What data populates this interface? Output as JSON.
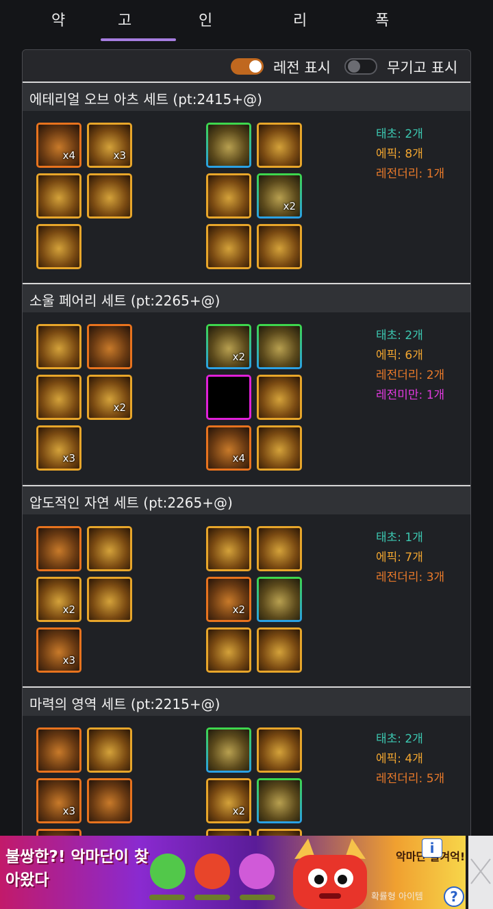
{
  "tabs": [
    {
      "label": "약",
      "active": false
    },
    {
      "label": "고",
      "active": true
    },
    {
      "label": "인",
      "active": false
    },
    {
      "label": "리",
      "active": false
    },
    {
      "label": "폭",
      "active": false
    }
  ],
  "toolbar": {
    "legend_toggle_label": "레전 표시",
    "legend_toggle_on": true,
    "weapon_toggle_label": "무기고 표시",
    "weapon_toggle_on": false
  },
  "sets": [
    {
      "title": "에테리얼 오브 아츠 세트 (pt:2415+@)",
      "left_slots": [
        {
          "frame": "orange",
          "icon": "gloves-icon",
          "count": "x4"
        },
        {
          "frame": "gold",
          "icon": "armor-icon",
          "count": "x3"
        },
        {
          "frame": "gold",
          "icon": "pants-icon",
          "count": ""
        },
        {
          "frame": "gold",
          "icon": "belt-icon",
          "count": ""
        },
        {
          "frame": "gold",
          "icon": "boots-icon",
          "count": ""
        }
      ],
      "right_slots": [
        {
          "frame": "lg",
          "icon": "bracelet-icon",
          "count": ""
        },
        {
          "frame": "gold",
          "icon": "necklace-icon",
          "count": ""
        },
        {
          "frame": "gold",
          "icon": "stone-icon",
          "count": ""
        },
        {
          "frame": "lg",
          "icon": "ring-icon",
          "count": "x2"
        },
        {
          "frame": "gold",
          "icon": "earring-icon",
          "count": ""
        },
        {
          "frame": "gold",
          "icon": "magic-stone-icon",
          "count": ""
        }
      ],
      "stats": [
        {
          "text": "태초: 2개",
          "tone": "teal"
        },
        {
          "text": "에픽: 8개",
          "tone": "orange"
        },
        {
          "text": "레전더리: 1개",
          "tone": "dorange"
        }
      ]
    },
    {
      "title": "소울 페어리 세트 (pt:2265+@)",
      "left_slots": [
        {
          "frame": "gold",
          "icon": "shoulder-icon",
          "count": ""
        },
        {
          "frame": "orange",
          "icon": "armor-icon",
          "count": ""
        },
        {
          "frame": "gold",
          "icon": "pants-icon",
          "count": ""
        },
        {
          "frame": "gold",
          "icon": "belt-icon",
          "count": "x2"
        },
        {
          "frame": "gold",
          "icon": "boots-icon",
          "count": "x3"
        }
      ],
      "right_slots": [
        {
          "frame": "lg",
          "icon": "bracelet-icon",
          "count": "x2"
        },
        {
          "frame": "lg",
          "icon": "necklace-icon",
          "count": ""
        },
        {
          "frame": "magenta",
          "icon": "empty-slot-icon",
          "count": ""
        },
        {
          "frame": "gold",
          "icon": "stone-icon",
          "count": ""
        },
        {
          "frame": "orange",
          "icon": "earring-icon",
          "count": "x4"
        },
        {
          "frame": "gold",
          "icon": "heart-icon",
          "count": ""
        }
      ],
      "stats": [
        {
          "text": "태초: 2개",
          "tone": "teal"
        },
        {
          "text": "에픽: 6개",
          "tone": "orange"
        },
        {
          "text": "레전더리: 2개",
          "tone": "dorange"
        },
        {
          "text": "레전미만: 1개",
          "tone": "magenta"
        }
      ]
    },
    {
      "title": "압도적인 자연 세트 (pt:2265+@)",
      "left_slots": [
        {
          "frame": "orange",
          "icon": "armor-icon",
          "count": ""
        },
        {
          "frame": "gold",
          "icon": "shoulder-icon",
          "count": ""
        },
        {
          "frame": "gold",
          "icon": "pants-icon",
          "count": "x2"
        },
        {
          "frame": "gold",
          "icon": "belt-icon",
          "count": ""
        },
        {
          "frame": "orange",
          "icon": "boots-icon",
          "count": "x3"
        }
      ],
      "right_slots": [
        {
          "frame": "gold",
          "icon": "bracelet-icon",
          "count": ""
        },
        {
          "frame": "gold",
          "icon": "necklace-icon",
          "count": ""
        },
        {
          "frame": "orange",
          "icon": "ring-icon",
          "count": "x2"
        },
        {
          "frame": "lg",
          "icon": "ring-icon",
          "count": ""
        },
        {
          "frame": "gold",
          "icon": "earring-icon",
          "count": ""
        },
        {
          "frame": "gold",
          "icon": "magic-stone-icon",
          "count": ""
        }
      ],
      "stats": [
        {
          "text": "태초: 1개",
          "tone": "teal"
        },
        {
          "text": "에픽: 7개",
          "tone": "orange"
        },
        {
          "text": "레전더리: 3개",
          "tone": "dorange"
        }
      ]
    },
    {
      "title": "마력의 영역 세트 (pt:2215+@)",
      "left_slots": [
        {
          "frame": "orange",
          "icon": "hat-icon",
          "count": ""
        },
        {
          "frame": "gold",
          "icon": "armor-icon",
          "count": ""
        },
        {
          "frame": "orange",
          "icon": "pants-icon",
          "count": "x3"
        },
        {
          "frame": "orange",
          "icon": "belt-icon",
          "count": ""
        },
        {
          "frame": "orange",
          "icon": "boots-icon",
          "count": ""
        }
      ],
      "right_slots": [
        {
          "frame": "lg",
          "icon": "bracelet-icon",
          "count": ""
        },
        {
          "frame": "gold",
          "icon": "necklace-icon",
          "count": ""
        },
        {
          "frame": "gold",
          "icon": "ring-icon",
          "count": "x2"
        },
        {
          "frame": "lg",
          "icon": "ring-icon",
          "count": ""
        },
        {
          "frame": "gold",
          "icon": "earring-icon",
          "count": ""
        },
        {
          "frame": "gold",
          "icon": "magic-stone-icon",
          "count": ""
        }
      ],
      "stats": [
        {
          "text": "태초: 2개",
          "tone": "teal"
        },
        {
          "text": "에픽: 4개",
          "tone": "orange"
        },
        {
          "text": "레전더리: 5개",
          "tone": "dorange"
        }
      ]
    }
  ],
  "ad": {
    "title": "불쌍한?! 악마단이 찾아왔다",
    "right_text": "악마단 몰겨억!",
    "sub_text": "확률형 아이템",
    "info_label": "i",
    "help_label": "?"
  },
  "colors": {
    "accent_tab": "#a67de0",
    "toggle_on": "#c0681f",
    "frame_gold": "#e8a62a",
    "frame_orange": "#e8731e",
    "frame_magenta": "#e020d8",
    "stat_teal": "#3cc9b2",
    "stat_orange": "#f2a630",
    "stat_dorange": "#ea7a2a",
    "stat_magenta": "#e23ae0"
  }
}
